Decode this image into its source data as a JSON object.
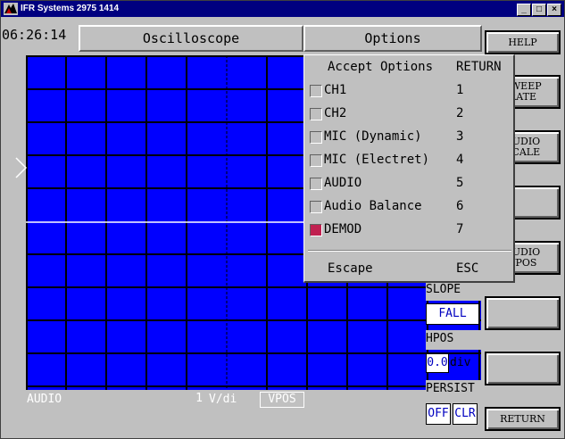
{
  "window": {
    "title": "IFR Systems 2975 1414",
    "controls": [
      "_",
      "□",
      "×"
    ]
  },
  "header": {
    "clock": "06:26:14",
    "mode": "Oscilloscope",
    "options": "Options"
  },
  "right_buttons": [
    {
      "label": "HELP"
    },
    {
      "label1": "SWEEP",
      "label2": "RATE"
    },
    {
      "label1": "AUDIO",
      "label2": "SCALE"
    },
    {
      "label1": "",
      "label2": ""
    },
    {
      "label1": "AUDIO",
      "label2": "VPOS"
    },
    {
      "label1": "",
      "label2": ""
    },
    {
      "label1": "",
      "label2": ""
    },
    {
      "label": "RETURN"
    }
  ],
  "scope": {
    "channel": "AUDIO",
    "scale_value": "1",
    "scale_unit": "V/di",
    "vpos": "VPOS"
  },
  "side_panel": {
    "slope_label": "SLOPE",
    "slope_value": "FALL",
    "hpos_label": "HPOS",
    "hpos_value": "0.0",
    "hpos_unit": "div",
    "persist_label": "PERSIST",
    "persist_off": "OFF",
    "persist_clr": "CLR"
  },
  "menu": {
    "header_label": "Accept Options",
    "header_key": "RETURN",
    "items": [
      {
        "label": "CH1",
        "key": "1",
        "checked": false
      },
      {
        "label": "CH2",
        "key": "2",
        "checked": false
      },
      {
        "label": "MIC (Dynamic)",
        "key": "3",
        "checked": false
      },
      {
        "label": "MIC (Electret)",
        "key": "4",
        "checked": false
      },
      {
        "label": "AUDIO",
        "key": "5",
        "checked": false
      },
      {
        "label": "Audio Balance",
        "key": "6",
        "checked": false
      },
      {
        "label": "DEMOD",
        "key": "7",
        "checked": true
      }
    ],
    "escape_label": "Escape",
    "escape_key": "ESC"
  },
  "colors": {
    "title_bar": "#000080",
    "scope_bg": "#0000ff",
    "grid": "#000000",
    "trace": "#ffffff",
    "checked": "#c02050"
  }
}
